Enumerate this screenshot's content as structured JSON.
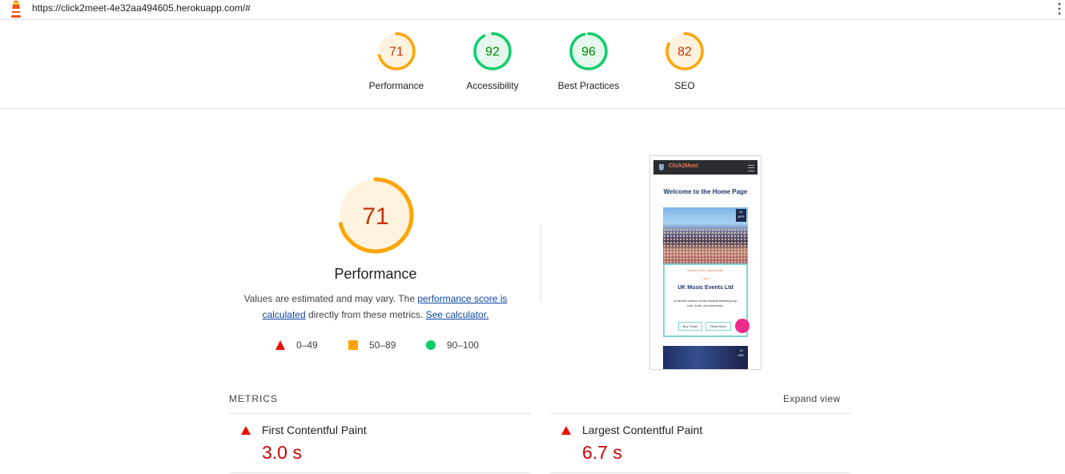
{
  "browser": {
    "url": "https://click2meet-4e32aa494605.herokuapp.com/#",
    "logo_icon": "lighthouse-icon",
    "menu_icon": "kebab-menu-icon"
  },
  "colors": {
    "fail": "#eb0f00",
    "average": "#ffa400",
    "pass": "#0cce6b",
    "average_text": "#c33300",
    "pass_text": "#008800",
    "link": "#0d47a1"
  },
  "scores": [
    {
      "label": "Performance",
      "value": "71",
      "score": 71,
      "rating": "average"
    },
    {
      "label": "Accessibility",
      "value": "92",
      "score": 92,
      "rating": "pass"
    },
    {
      "label": "Best Practices",
      "value": "96",
      "score": 96,
      "rating": "pass"
    },
    {
      "label": "SEO",
      "value": "82",
      "score": 82,
      "rating": "average"
    }
  ],
  "performance": {
    "value": "71",
    "score": 71,
    "title": "Performance",
    "desc_before": "Values are estimated and may vary. The ",
    "link1": "performance score is calculated",
    "desc_middle": " directly from these metrics. ",
    "link2": "See calculator."
  },
  "legend": [
    {
      "range": "0–49",
      "shape": "triangle",
      "color": "#eb0f00"
    },
    {
      "range": "50–89",
      "shape": "square",
      "color": "#ffa400"
    },
    {
      "range": "90–100",
      "shape": "circle",
      "color": "#0cce6b"
    }
  ],
  "screenshot": {
    "brand": "Click2Meet",
    "heading": "Welcome to the Home Page",
    "date1": "31 APR",
    "location": "Heaton Park, Manchester",
    "time": "7 p.m.",
    "organizer": "UK Music Events Ltd",
    "blurb": "A vibrant outdoor music festival featuring top rock, indie, and electronic.",
    "buy_button": "Buy Ticket",
    "read_button": "Read More",
    "date2": "13 MAY"
  },
  "metrics": {
    "header": "METRICS",
    "expand": "Expand view",
    "items": [
      {
        "name": "First Contentful Paint",
        "value": "3.0 s",
        "rating": "fail"
      },
      {
        "name": "Largest Contentful Paint",
        "value": "6.7 s",
        "rating": "fail"
      }
    ]
  }
}
